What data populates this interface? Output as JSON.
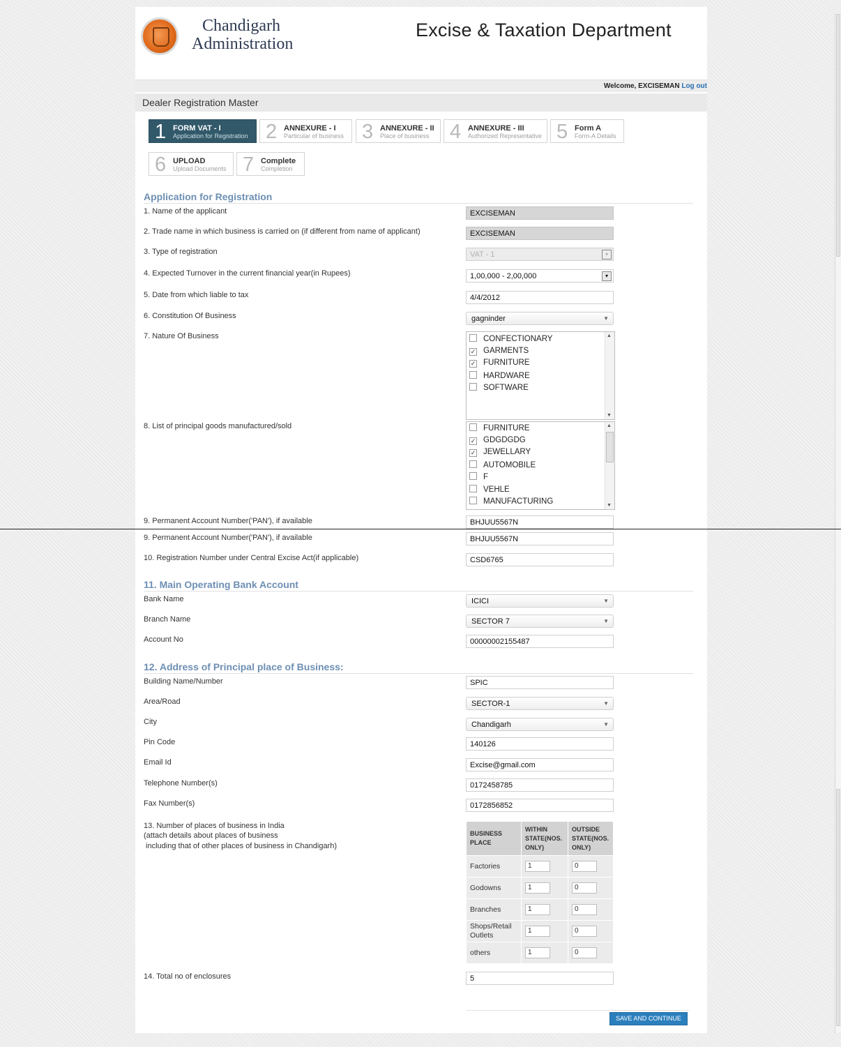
{
  "header": {
    "brand_line1": "Chandigarh",
    "brand_line2": "Administration",
    "department": "Excise & Taxation Department"
  },
  "user_bar": {
    "welcome": "Welcome, EXCISEMAN",
    "logout": "Log out"
  },
  "page_title": "Dealer Registration Master",
  "steps": [
    {
      "num": "1",
      "label": "FORM VAT - I",
      "sub": "Application for Registration",
      "active": true
    },
    {
      "num": "2",
      "label": "ANNEXURE - I",
      "sub": "Particular of business"
    },
    {
      "num": "3",
      "label": "ANNEXURE - II",
      "sub": "Place of business"
    },
    {
      "num": "4",
      "label": "ANNEXURE - III",
      "sub": "Authorized Representative"
    },
    {
      "num": "5",
      "label": "Form A",
      "sub": "Form-A Details"
    },
    {
      "num": "6",
      "label": "UPLOAD",
      "sub": "Upload Documents"
    },
    {
      "num": "7",
      "label": "Complete",
      "sub": "Completion"
    }
  ],
  "section_application": "Application for Registration",
  "fields": {
    "applicant_name": {
      "label": "1. Name of the applicant",
      "value": "EXCISEMAN"
    },
    "trade_name": {
      "label": "2. Trade name in which business is carried on (if different from name of applicant)",
      "value": "EXCISEMAN"
    },
    "reg_type": {
      "label": "3. Type of registration",
      "value": "VAT - 1"
    },
    "turnover": {
      "label": "4. Expected Turnover in the current financial year(in Rupees)",
      "value": "1,00,000 - 2,00,000"
    },
    "liable_date": {
      "label": "5. Date from which liable to tax",
      "value": "4/4/2012"
    },
    "constitution": {
      "label": "6. Constitution Of Business",
      "value": "gagninder"
    },
    "nature": {
      "label": "7. Nature Of Business"
    },
    "goods": {
      "label": "8. List of principal goods manufactured/sold"
    },
    "pan": {
      "label": "9. Permanent Account Number('PAN'), if available",
      "value": "BHJUU5567N"
    },
    "central_excise": {
      "label": "10. Registration Number under Central Excise Act(if applicable)",
      "value": "CSD6765"
    }
  },
  "nature_options": [
    {
      "label": "CONFECTIONARY",
      "checked": false
    },
    {
      "label": "GARMENTS",
      "checked": true
    },
    {
      "label": "FURNITURE",
      "checked": true
    },
    {
      "label": "HARDWARE",
      "checked": false
    },
    {
      "label": "SOFTWARE",
      "checked": false
    }
  ],
  "goods_options": [
    {
      "label": "FURNITURE",
      "checked": false
    },
    {
      "label": "GDGDGDG",
      "checked": true
    },
    {
      "label": "JEWELLARY",
      "checked": true
    },
    {
      "label": "AUTOMOBILE",
      "checked": false
    },
    {
      "label": "F",
      "checked": false
    },
    {
      "label": "VEHLE",
      "checked": false
    },
    {
      "label": "MANUFACTURING",
      "checked": false
    }
  ],
  "bank": {
    "heading": "11. Main Operating Bank Account",
    "bank_name_label": "Bank Name",
    "bank_name": "ICICI",
    "branch_label": "Branch Name",
    "branch": "SECTOR 7",
    "account_label": "Account No",
    "account": "00000002155487"
  },
  "address": {
    "heading": "12. Address of Principal place of Business:",
    "building_label": "Building Name/Number",
    "building": "SPIC",
    "area_label": "Area/Road",
    "area": "SECTOR-1",
    "city_label": "City",
    "city": "Chandigarh",
    "pin_label": "Pin Code",
    "pin": "140126",
    "email_label": "Email Id",
    "email": "Excise@gmail.com",
    "phone_label": "Telephone Number(s)",
    "phone": "0172458785",
    "fax_label": "Fax Number(s)",
    "fax": "0172856852"
  },
  "places": {
    "label_line1": "13. Number of places of business in India",
    "label_line2": "(attach details about places of business",
    "label_line3": " including that of other places of business in Chandigarh)",
    "headers": [
      "BUSINESS PLACE",
      "WITHIN STATE(NOS. ONLY)",
      "OUTSIDE STATE(NOS. ONLY)"
    ],
    "rows": [
      {
        "name": "Factories",
        "within": "1",
        "outside": "0"
      },
      {
        "name": "Godowns",
        "within": "1",
        "outside": "0"
      },
      {
        "name": "Branches",
        "within": "1",
        "outside": "0"
      },
      {
        "name": "Shops/Retail Outlets",
        "within": "1",
        "outside": "0"
      },
      {
        "name": "others",
        "within": "1",
        "outside": "0"
      }
    ]
  },
  "enclosures": {
    "label": "14. Total no of enclosures",
    "value": "5"
  },
  "save_button": "SAVE AND CONTINUE"
}
